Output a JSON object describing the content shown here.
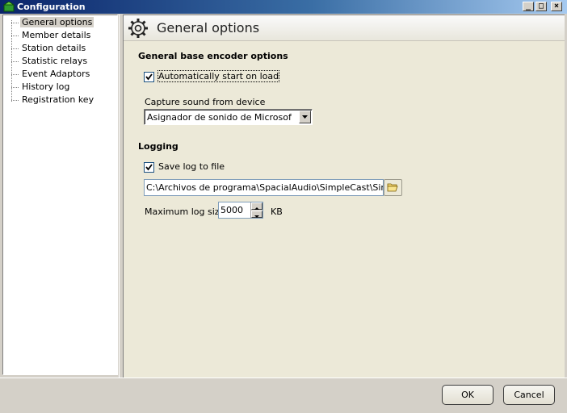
{
  "window": {
    "title": "Configuration",
    "controls": {
      "minimize": "_",
      "maximize": "□",
      "close": "×"
    }
  },
  "tree": {
    "items": [
      {
        "label": "General options",
        "selected": true
      },
      {
        "label": "Member details"
      },
      {
        "label": "Station details"
      },
      {
        "label": "Statistic relays"
      },
      {
        "label": "Event Adaptors"
      },
      {
        "label": "History log"
      },
      {
        "label": "Registration key"
      }
    ]
  },
  "panel": {
    "header_title": "General options",
    "encoder_section": {
      "title": "General base encoder options",
      "auto_start": {
        "label": "Automatically start on load",
        "checked": true
      },
      "capture_label": "Capture sound from device",
      "capture_value": "Asignador de sonido de Microsof"
    },
    "logging_section": {
      "title": "Logging",
      "save_log": {
        "label": "Save log to file",
        "checked": true
      },
      "log_path": "C:\\Archivos de programa\\SpacialAudio\\SimpleCast\\SimpleCa",
      "max_size_label": "Maximum log size",
      "max_size_value": "5000",
      "max_size_unit": "KB"
    }
  },
  "footer": {
    "ok_label": "OK",
    "cancel_label": "Cancel"
  },
  "icons": {
    "app": "green-speaker-icon",
    "header": "gear-icon",
    "browse": "folder-open-icon"
  },
  "colors": {
    "titlebar_start": "#0a246a",
    "titlebar_end": "#a6caf0",
    "panel_bg": "#ece9d8"
  }
}
